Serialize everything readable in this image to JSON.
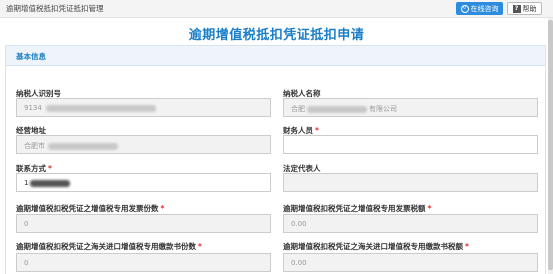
{
  "window": {
    "title": "逾期增值税抵扣凭证抵扣管理"
  },
  "toolbar": {
    "online_service_label": "在线咨询",
    "help_label": "帮助"
  },
  "page": {
    "title": "逾期增值税抵扣凭证抵扣申请"
  },
  "section": {
    "title": "基本信息"
  },
  "form": {
    "taxpayer_id": {
      "label": "纳税人识别号",
      "value": "9134"
    },
    "taxpayer_name": {
      "label": "纳税人名称",
      "value_prefix": "合肥",
      "value_suffix": "有限公司"
    },
    "address": {
      "label": "经营地址",
      "value": "合肥市"
    },
    "finance_staff": {
      "label": "财务人员",
      "required": "*",
      "value": ""
    },
    "contact": {
      "label": "联系方式",
      "required": "*",
      "value": "1"
    },
    "legal_rep": {
      "label": "法定代表人",
      "value": ""
    },
    "invoice_count": {
      "label": "逾期增值税扣税凭证之增值税专用发票份数",
      "required": "*",
      "value": "0"
    },
    "invoice_tax": {
      "label": "逾期增值税扣税凭证之增值税专用发票税额",
      "required": "*",
      "value": "0.00"
    },
    "customs_count": {
      "label": "逾期增值税扣税凭证之海关进口增值税专用缴款书份数",
      "required": "*",
      "value": "0"
    },
    "customs_tax": {
      "label": "逾期增值税扣税凭证之海关进口增值税专用缴款书税额",
      "required": "*",
      "value": "0.00"
    }
  },
  "icons": {
    "service": "refresh-circle-icon",
    "help": "question-icon"
  },
  "colors": {
    "accent": "#1a7fc8",
    "button": "#2d8cdd",
    "required": "#e03030"
  }
}
